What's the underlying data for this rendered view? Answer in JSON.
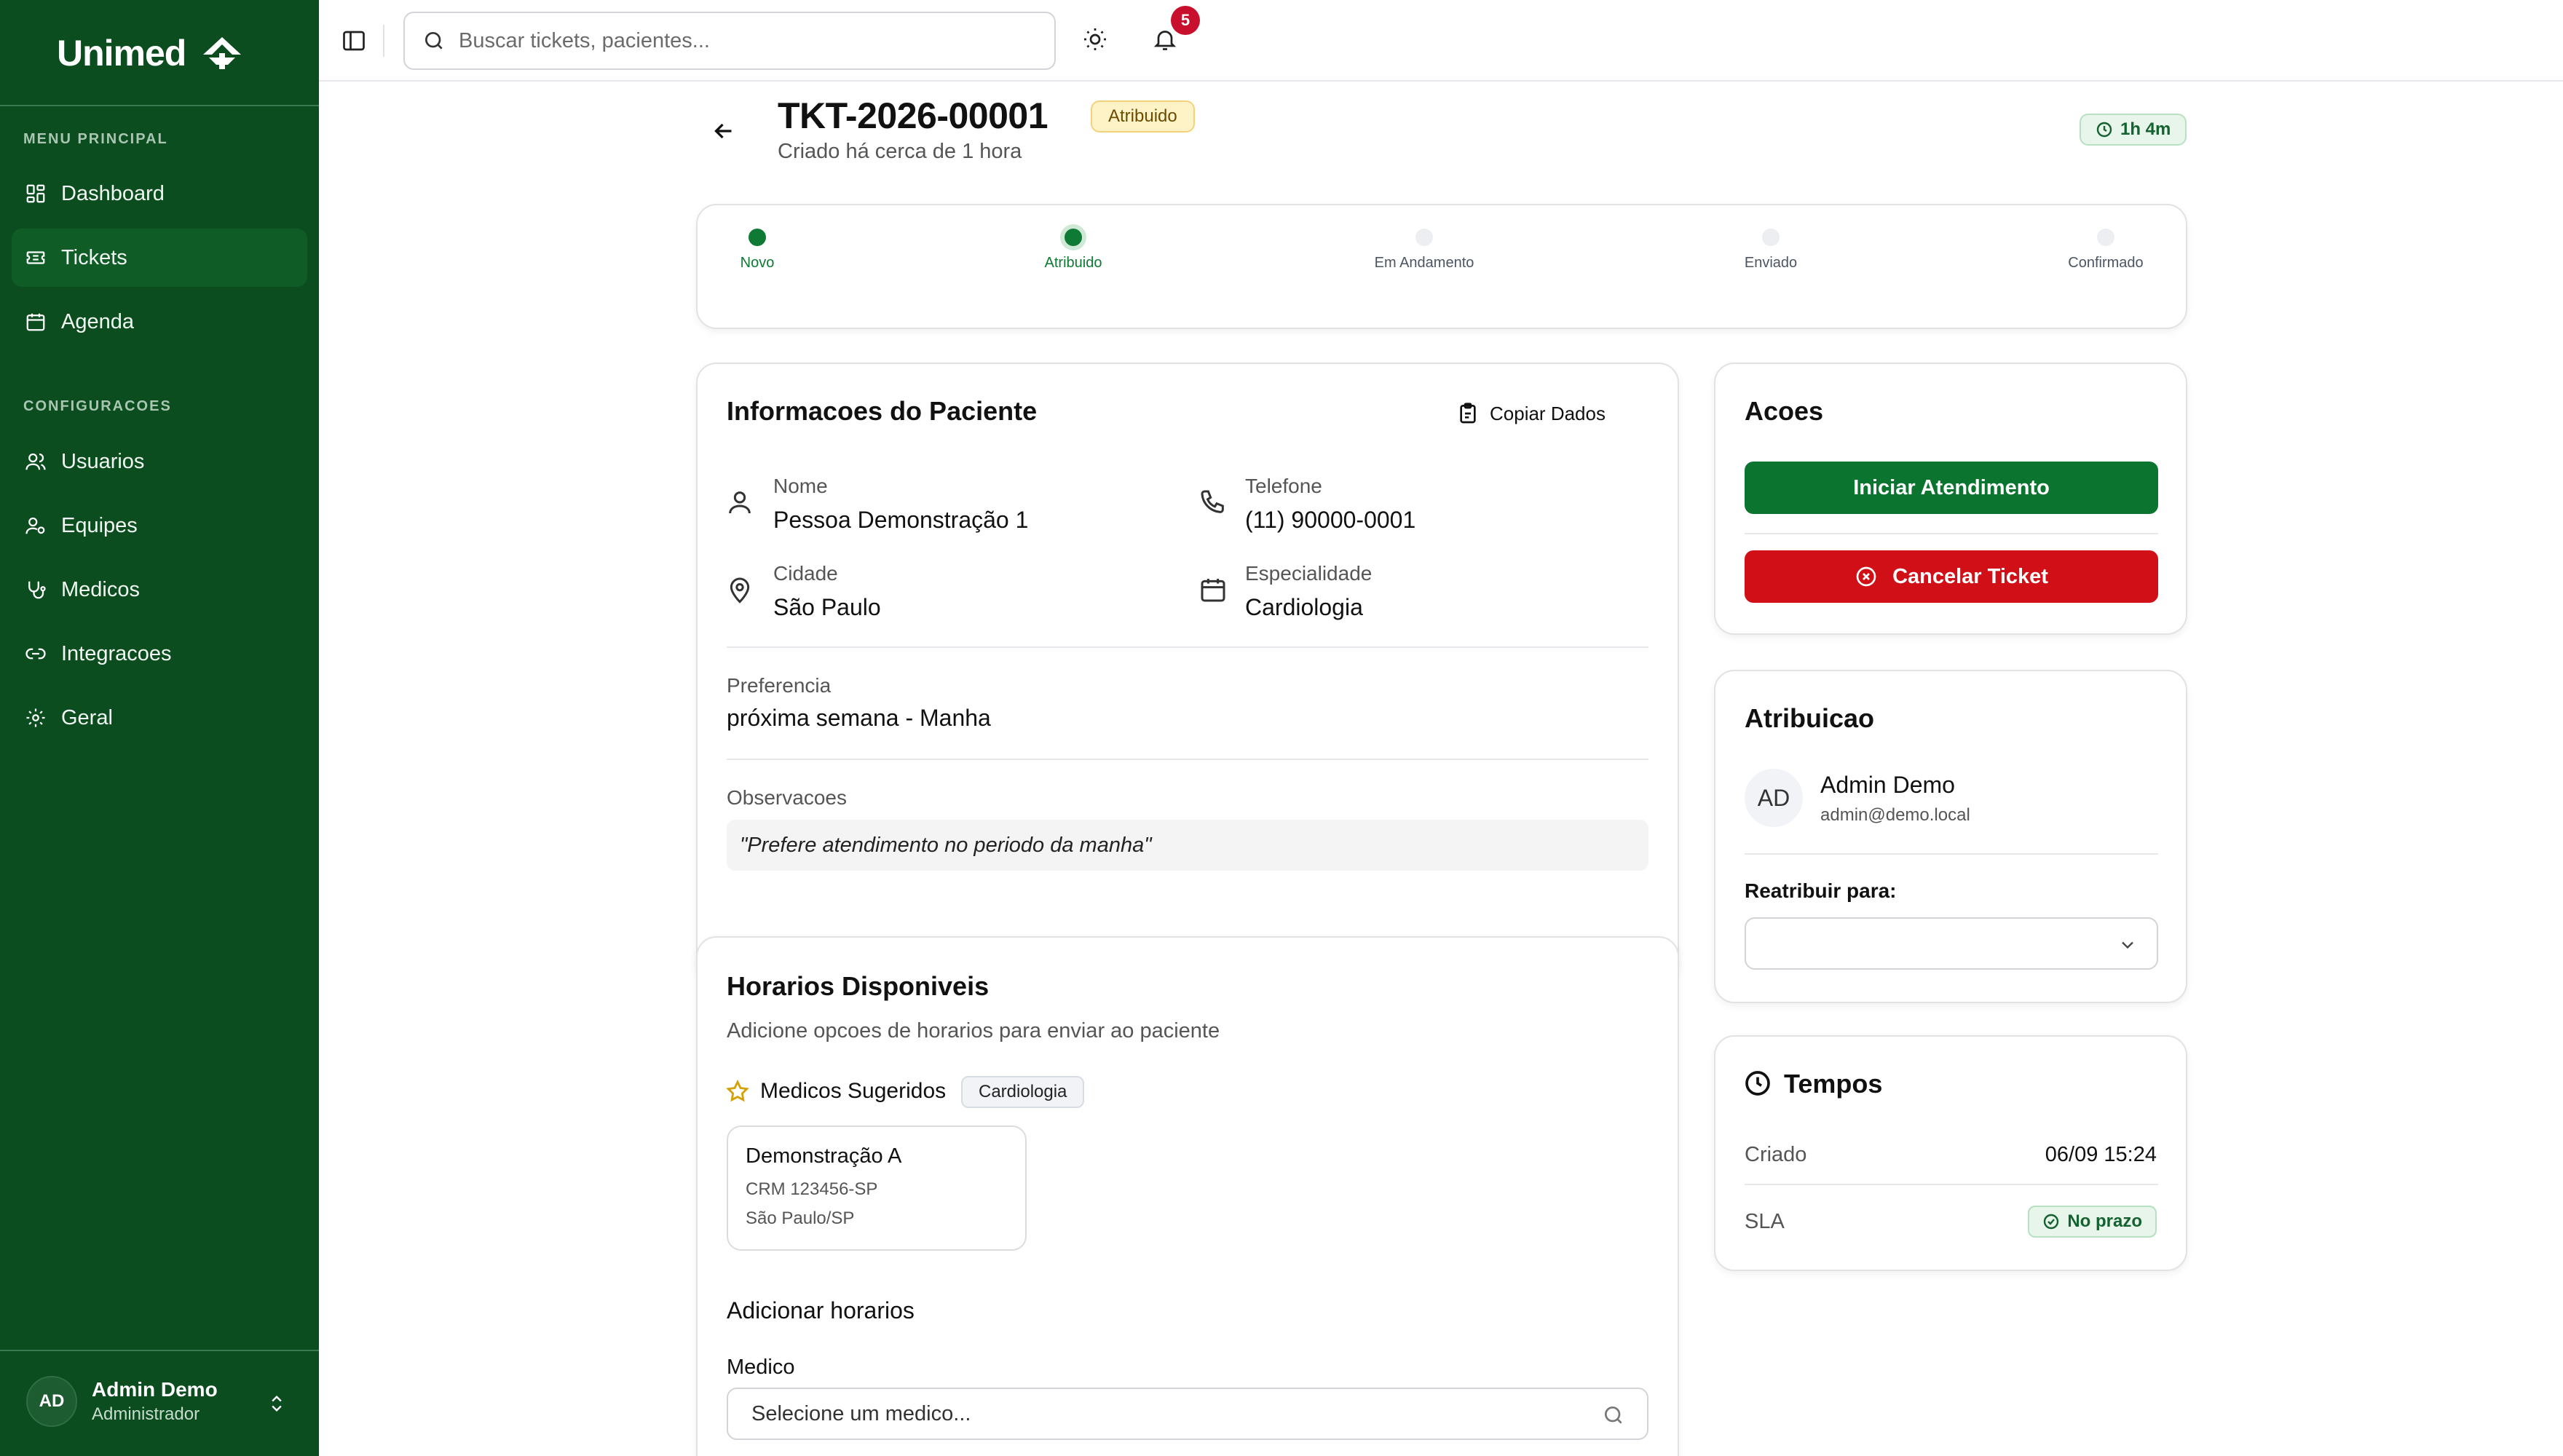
{
  "brand": {
    "name": "Unimed",
    "color": "#0b4d1f",
    "accent": "#0b7530",
    "danger": "#d10f16"
  },
  "sidebar": {
    "section_main": "MENU PRINCIPAL",
    "main_items": [
      {
        "label": "Dashboard",
        "icon": "dashboard-icon"
      },
      {
        "label": "Tickets",
        "icon": "ticket-icon",
        "active": true
      },
      {
        "label": "Agenda",
        "icon": "calendar-icon"
      }
    ],
    "section_config": "CONFIGURACOES",
    "config_items": [
      {
        "label": "Usuarios",
        "icon": "users-icon"
      },
      {
        "label": "Equipes",
        "icon": "team-icon"
      },
      {
        "label": "Medicos",
        "icon": "stethoscope-icon"
      },
      {
        "label": "Integracoes",
        "icon": "link-icon"
      },
      {
        "label": "Geral",
        "icon": "gear-icon"
      }
    ],
    "user": {
      "initials": "AD",
      "name": "Admin Demo",
      "role": "Administrador"
    }
  },
  "topbar": {
    "search_placeholder": "Buscar tickets, pacientes...",
    "notification_count": "5"
  },
  "ticket": {
    "id": "TKT-2026-00001",
    "status": "Atribuido",
    "created": "Criado há cerca de 1 hora",
    "elapsed": "1h 4m"
  },
  "steps": [
    {
      "label": "Novo",
      "state": "done"
    },
    {
      "label": "Atribuido",
      "state": "current"
    },
    {
      "label": "Em Andamento",
      "state": "todo"
    },
    {
      "label": "Enviado",
      "state": "todo"
    },
    {
      "label": "Confirmado",
      "state": "todo"
    }
  ],
  "patient": {
    "title": "Informacoes do Paciente",
    "copy_label": "Copiar Dados",
    "name_label": "Nome",
    "name": "Pessoa Demonstração 1",
    "phone_label": "Telefone",
    "phone": "(11) 90000-0001",
    "city_label": "Cidade",
    "city": "São Paulo",
    "specialty_label": "Especialidade",
    "specialty": "Cardiologia",
    "preference_label": "Preferencia",
    "preference": "próxima semana - Manha",
    "notes_label": "Observacoes",
    "notes": "\"Prefere atendimento no periodo da manha\""
  },
  "schedule": {
    "title": "Horarios Disponiveis",
    "subtitle": "Adicione opcoes de horarios para enviar ao paciente",
    "suggested_label": "Medicos Sugeridos",
    "suggested_specialty": "Cardiologia",
    "doctor": {
      "name": "Demonstração A",
      "crm": "CRM 123456-SP",
      "location": "São Paulo/SP"
    },
    "add_title": "Adicionar horarios",
    "doctor_field_label": "Medico",
    "doctor_placeholder": "Selecione um medico..."
  },
  "actions": {
    "title": "Acoes",
    "start": "Iniciar Atendimento",
    "cancel": "Cancelar Ticket"
  },
  "assignment": {
    "title": "Atribuicao",
    "initials": "AD",
    "name": "Admin Demo",
    "email": "admin@demo.local",
    "reassign_label": "Reatribuir para:",
    "reassign_value": ""
  },
  "times": {
    "title": "Tempos",
    "created_label": "Criado",
    "created_value": "06/09 15:24",
    "sla_label": "SLA",
    "sla_value": "No prazo"
  }
}
